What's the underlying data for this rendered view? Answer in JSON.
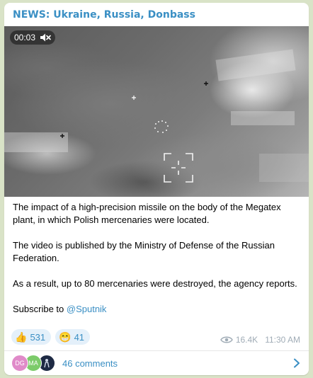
{
  "post": {
    "channel_name": "NEWS: Ukraine, Russia, Donbass",
    "video": {
      "time": "00:03",
      "mute_icon": "muted-speaker-icon"
    },
    "paragraphs": [
      "The impact of a high-precision missile on the body of the Megatex plant, in which Polish mercenaries were located.",
      "The video is published by the Ministry of Defense of the Russian Federation.",
      "As a result, up to 80 mercenaries were destroyed, the agency reports."
    ],
    "subscribe_prefix": "Subscribe to ",
    "subscribe_mention": "@Sputnik",
    "reactions": [
      {
        "emoji": "👍",
        "icon": "thumbs-up-icon",
        "count": "531"
      },
      {
        "emoji": "😁",
        "icon": "grinning-face-icon",
        "count": "41"
      }
    ],
    "views": "16.4K",
    "time": "11:30 AM",
    "comments": {
      "label": "46 comments",
      "avatars": [
        {
          "initials": "DG",
          "color": "#e08ac9"
        },
        {
          "initials": "MA",
          "color": "#7ccb6a"
        },
        {
          "initials": "",
          "color": "#1e2a44"
        }
      ]
    }
  },
  "colors": {
    "accent": "#3a8fc4",
    "reaction_bg": "#e4f0fa",
    "chat_bg": "#d9e3c7"
  }
}
